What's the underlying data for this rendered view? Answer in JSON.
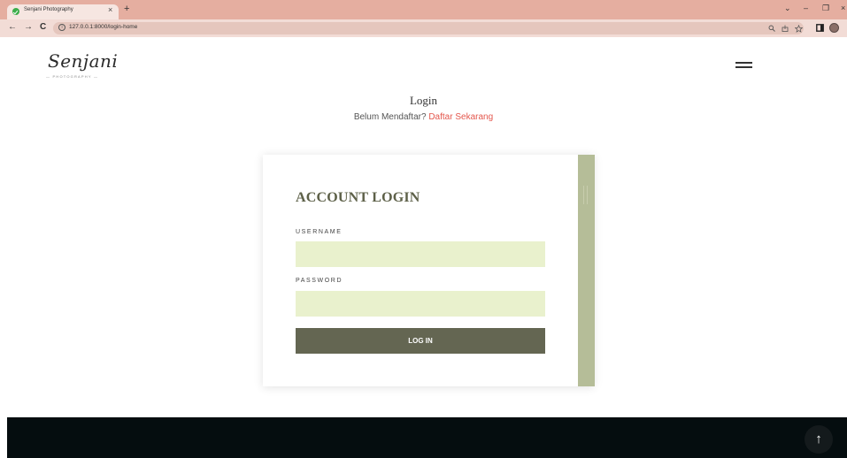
{
  "browser": {
    "tab_title": "Senjani Photography",
    "tab_close": "×",
    "new_tab": "+",
    "url": "127.0.0.1:8000/login-home",
    "info_icon": "i",
    "controls": {
      "dropdown": "⌄",
      "minimize": "–",
      "restore": "❐",
      "close": "×"
    },
    "nav": {
      "back": "←",
      "forward": "→",
      "reload": "C"
    }
  },
  "header": {
    "logo_text": "Senjani",
    "logo_sub": "— PHOTOGRAPHY —"
  },
  "page": {
    "heading": "Login",
    "register_prompt": "Belum Mendaftar?",
    "register_link": "Daftar Sekarang"
  },
  "login_card": {
    "title": "ACCOUNT LOGIN",
    "username_label": "USERNAME",
    "username_value": "",
    "password_label": "PASSWORD",
    "password_value": "",
    "submit_label": "LOG IN"
  },
  "footer": {
    "scroll_top_icon": "↑"
  },
  "colors": {
    "tabbar": "#e5aea0",
    "accent_link": "#e4574d",
    "input_bg": "#e9f1cd",
    "button_bg": "#646652",
    "strip": "#b5bd98",
    "footer_bg": "#050d0f"
  }
}
